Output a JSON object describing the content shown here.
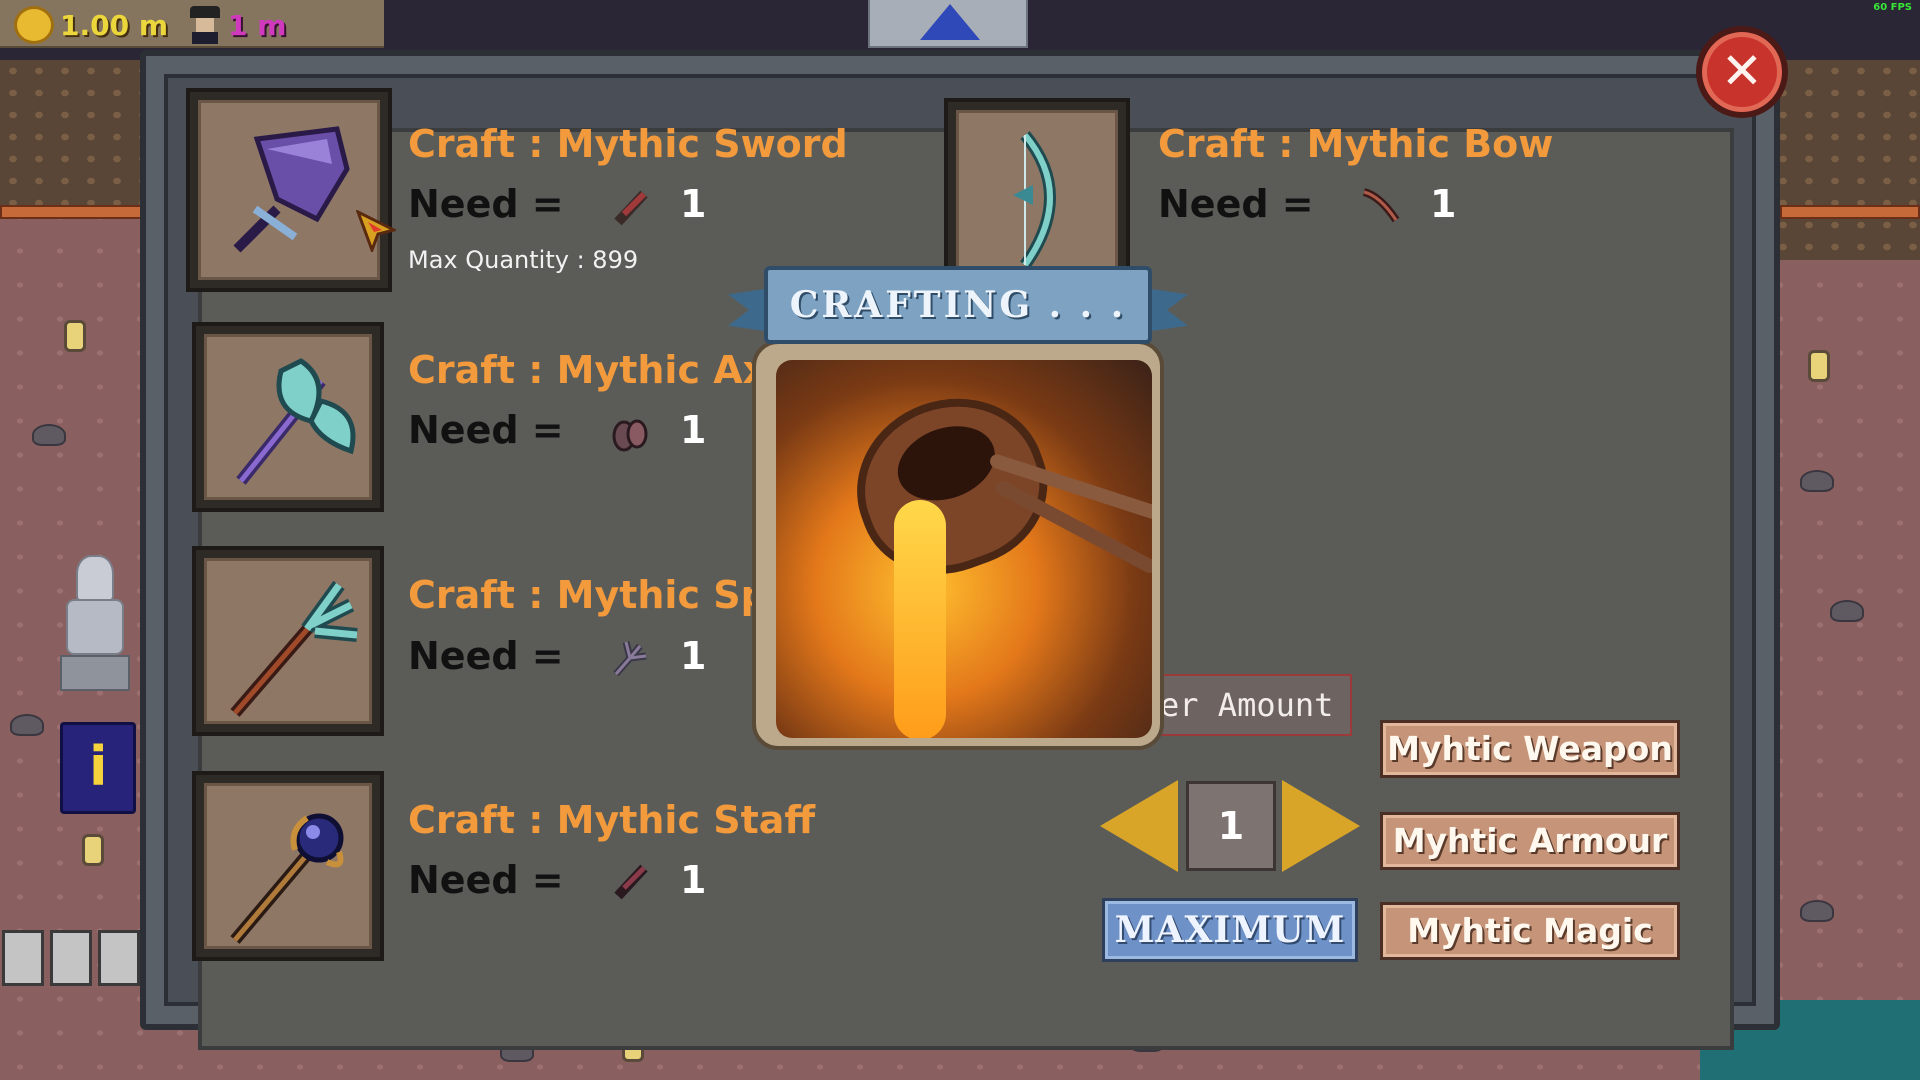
{
  "hud": {
    "gold": "1.00 m",
    "workers": "1 m",
    "fps": "60 FPS"
  },
  "items": [
    {
      "title": "Craft : Mythic Sword",
      "need_label": "Need =",
      "need_qty": "1",
      "max_quantity": "Max Quantity : 899",
      "icon": "mythic-sword-icon",
      "material_icon": "feather-quill-icon"
    },
    {
      "title": "Craft : Mythic Axe",
      "need_label": "Need =",
      "need_qty": "1",
      "icon": "mythic-axe-icon",
      "material_icon": "ore-chunk-icon"
    },
    {
      "title": "Craft : Mythic Spe",
      "need_label": "Need =",
      "need_qty": "1",
      "icon": "mythic-spear-icon",
      "material_icon": "claw-icon"
    },
    {
      "title": "Craft : Mythic Staff",
      "need_label": "Need =",
      "need_qty": "1",
      "icon": "mythic-staff-icon",
      "material_icon": "torch-stick-icon"
    },
    {
      "title": "Craft : Mythic Bow",
      "need_label": "Need =",
      "need_qty": "1",
      "icon": "mythic-bow-icon",
      "material_icon": "bow-limb-icon"
    }
  ],
  "crafting": {
    "banner": "CRAFTING . . ."
  },
  "controls": {
    "amount_placeholder": "er Amount",
    "quantity": "1",
    "maximum_label": "MAXIMUM"
  },
  "categories": {
    "weapon": "Myhtic Weapon",
    "armour": "Myhtic Armour",
    "magic": "Myhtic Magic"
  },
  "colors": {
    "title_orange": "#f29a3c",
    "gold_text": "#f6e03c",
    "worker_text": "#d93bc6",
    "close_red": "#c8342c",
    "maximum_blue": "#6e92c8",
    "category_tan": "#c69478"
  }
}
